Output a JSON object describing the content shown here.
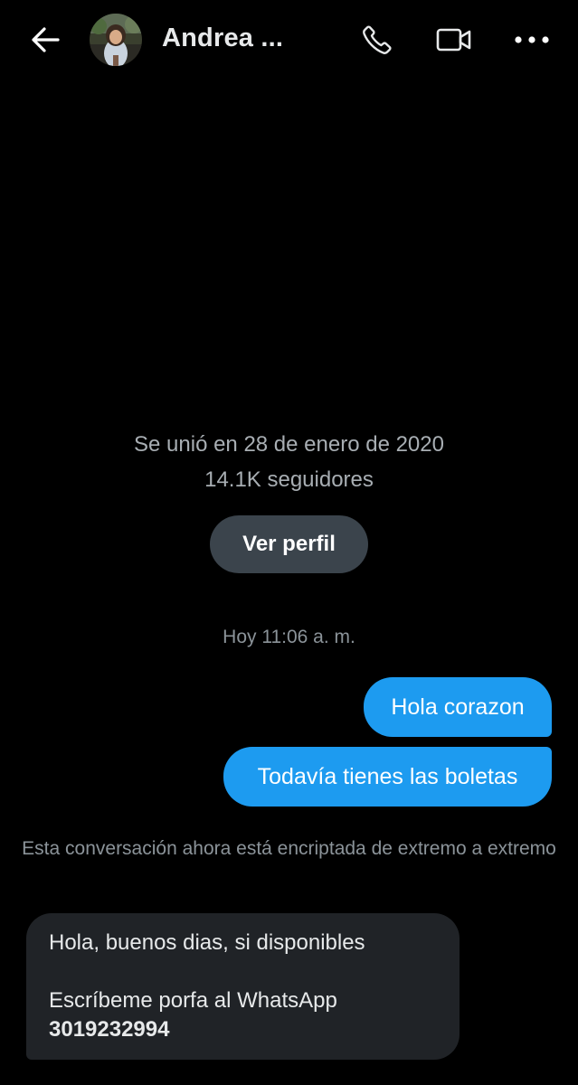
{
  "header": {
    "contact_name": "Andrea ...",
    "back_icon": "arrow-left-icon",
    "avatar": "contact-avatar",
    "actions": [
      "phone-icon",
      "video-camera-icon",
      "more-dots-icon"
    ]
  },
  "profile_summary": {
    "joined": "Se unió en 28 de enero de 2020",
    "followers": "14.1K seguidores",
    "view_profile_label": "Ver perfil"
  },
  "conversation": {
    "timestamp": "Hoy 11:06 a. m.",
    "outgoing": [
      "Hola corazon",
      "Todavía tienes las boletas"
    ],
    "encryption_notice": "Esta conversación ahora está encriptada de extremo a extremo",
    "incoming": {
      "line1": "Hola, buenos dias, si disponibles",
      "line2": "Escríbeme porfa al WhatsApp",
      "phone": "3019232994"
    }
  },
  "colors": {
    "background": "#000000",
    "outgoing_bubble": "#1d9bf0",
    "incoming_bubble": "#202327",
    "button": "#3b444c",
    "secondary_text": "#8b9399"
  }
}
